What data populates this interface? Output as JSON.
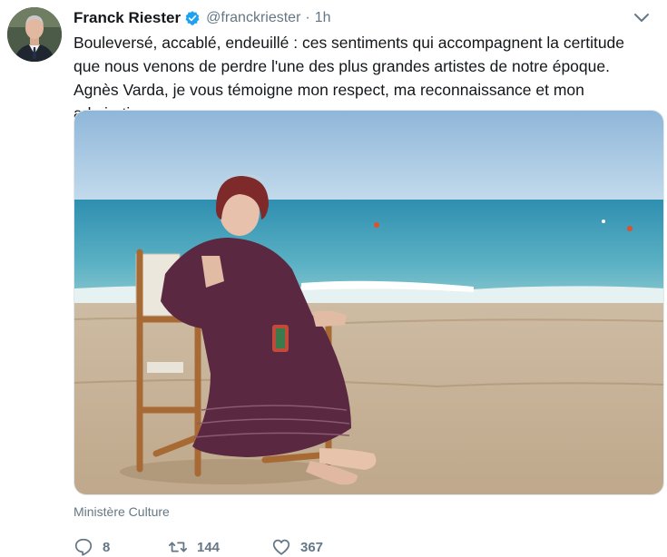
{
  "tweet": {
    "author_name": "Franck Riester",
    "author_handle": "@franckriester",
    "separator": "·",
    "time": "1h",
    "verified": true,
    "text": "Bouleversé, accablé, endeuillé : ces sentiments qui accompagnent la certitude que nous venons de perdre l'une des plus grandes artistes de notre époque. Agnès Varda, je vous témoigne mon respect, ma reconnaissance et mon admiration.",
    "media_credit": "Ministère Culture",
    "actions": {
      "replies": "8",
      "retweets": "144",
      "likes": "367"
    }
  },
  "colors": {
    "text": "#14171a",
    "secondary": "#657786",
    "verified_blue": "#1da1f2",
    "border": "#e1e8ed"
  },
  "icons": {
    "verified": "verified-badge-icon",
    "menu": "chevron-down-icon",
    "reply": "reply-icon",
    "retweet": "retweet-icon",
    "like": "heart-icon"
  }
}
